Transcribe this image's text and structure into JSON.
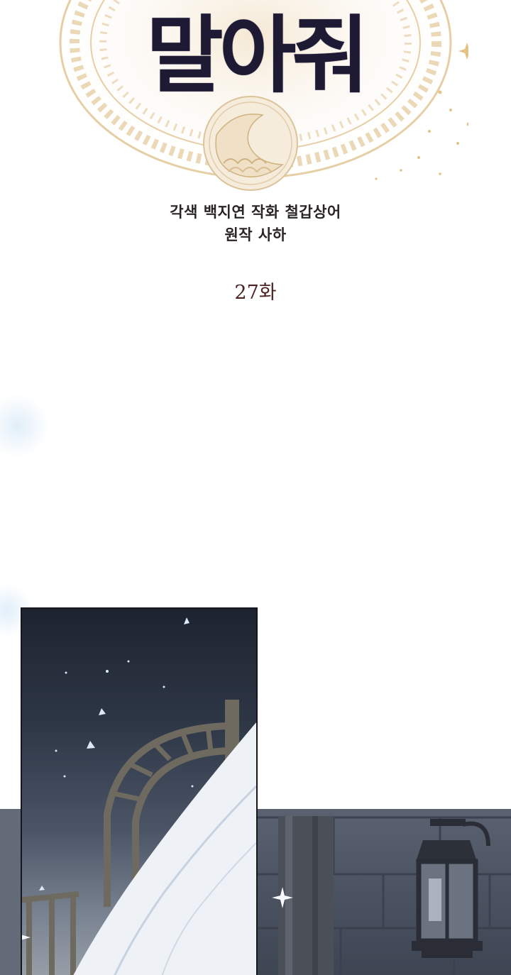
{
  "title": "말아줘",
  "credits": {
    "line1": "각색 백지연 작화 철갑상어",
    "line2": "원작 사하"
  },
  "episode": "27화",
  "colors": {
    "title": "#1e1a33",
    "gold_ornament": "#e3c79c",
    "credit_text": "#2b2424",
    "episode_text": "#4a2322",
    "night_sky": "#1d2330",
    "stone_wall": "#4c5362"
  }
}
